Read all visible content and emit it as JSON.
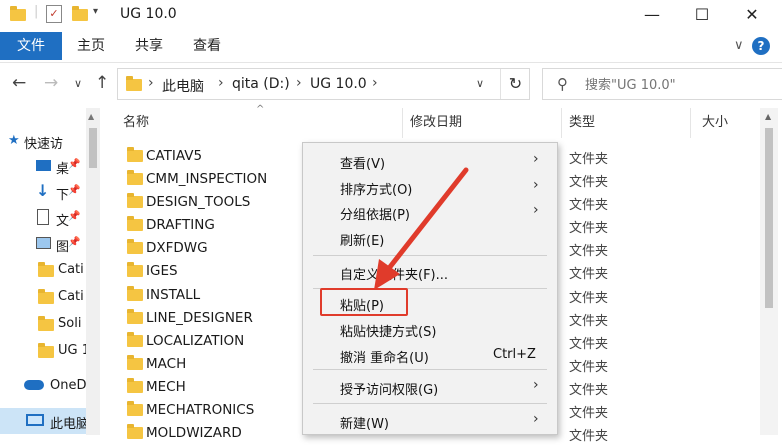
{
  "window": {
    "title": "UG 10.0",
    "controls": {
      "minimize": "—",
      "maximize": "☐",
      "close": "✕"
    }
  },
  "ribbon": {
    "tabs": [
      "文件",
      "主页",
      "共享",
      "查看"
    ],
    "expand": "∨",
    "help": "?"
  },
  "nav": {
    "back": "←",
    "forward": "→",
    "recent": "∨",
    "up": "↑",
    "path": [
      "此电脑",
      "qita (D:)",
      "UG 10.0"
    ],
    "sep": "›",
    "dropdown": "∨",
    "refresh": "↻",
    "search_placeholder": "搜索\"UG 10.0\""
  },
  "sidebar": {
    "items": [
      {
        "label": "快速访",
        "icon": "star-icon"
      },
      {
        "label": "桌",
        "icon": "desktop-icon"
      },
      {
        "label": "下",
        "icon": "download-icon"
      },
      {
        "label": "文",
        "icon": "document-icon"
      },
      {
        "label": "图",
        "icon": "picture-icon"
      },
      {
        "label": "Cati",
        "icon": "folder-icon"
      },
      {
        "label": "Cati",
        "icon": "folder-icon"
      },
      {
        "label": "Soli",
        "icon": "folder-icon"
      },
      {
        "label": "UG 1",
        "icon": "folder-icon"
      },
      {
        "label": "OneD",
        "icon": "cloud-icon"
      },
      {
        "label": "此电脑",
        "icon": "pc-icon"
      }
    ]
  },
  "columns": {
    "name": "名称",
    "modified": "修改日期",
    "type": "类型",
    "size": "大小"
  },
  "files": [
    {
      "name": "CATIAV5",
      "type": "文件夹"
    },
    {
      "name": "CMM_INSPECTION",
      "type": "文件夹"
    },
    {
      "name": "DESIGN_TOOLS",
      "type": "文件夹"
    },
    {
      "name": "DRAFTING",
      "type": "文件夹"
    },
    {
      "name": "DXFDWG",
      "type": "文件夹"
    },
    {
      "name": "IGES",
      "type": "文件夹"
    },
    {
      "name": "INSTALL",
      "type": "文件夹"
    },
    {
      "name": "LINE_DESIGNER",
      "type": "文件夹"
    },
    {
      "name": "LOCALIZATION",
      "type": "文件夹"
    },
    {
      "name": "MACH",
      "type": "文件夹"
    },
    {
      "name": "MECH",
      "type": "文件夹"
    },
    {
      "name": "MECHATRONICS",
      "type": "文件夹"
    },
    {
      "name": "MOLDWIZARD",
      "type": "文件夹"
    }
  ],
  "context_menu": {
    "items": [
      {
        "label": "查看(V)",
        "submenu": true
      },
      {
        "label": "排序方式(O)",
        "submenu": true
      },
      {
        "label": "分组依据(P)",
        "submenu": true
      },
      {
        "label": "刷新(E)"
      },
      {
        "label": "自定义文件夹(F)..."
      },
      {
        "label": "粘贴(P)"
      },
      {
        "label": "粘贴快捷方式(S)"
      },
      {
        "label": "撤消 重命名(U)",
        "shortcut": "Ctrl+Z"
      },
      {
        "label": "授予访问权限(G)",
        "submenu": true
      },
      {
        "label": "新建(W)",
        "submenu": true
      }
    ],
    "submenu_glyph": "›",
    "highlight_color": "#e03b2b"
  },
  "colors": {
    "accent": "#1f6fc2",
    "folder": "#f5c542",
    "annotation": "#e03b2b"
  }
}
